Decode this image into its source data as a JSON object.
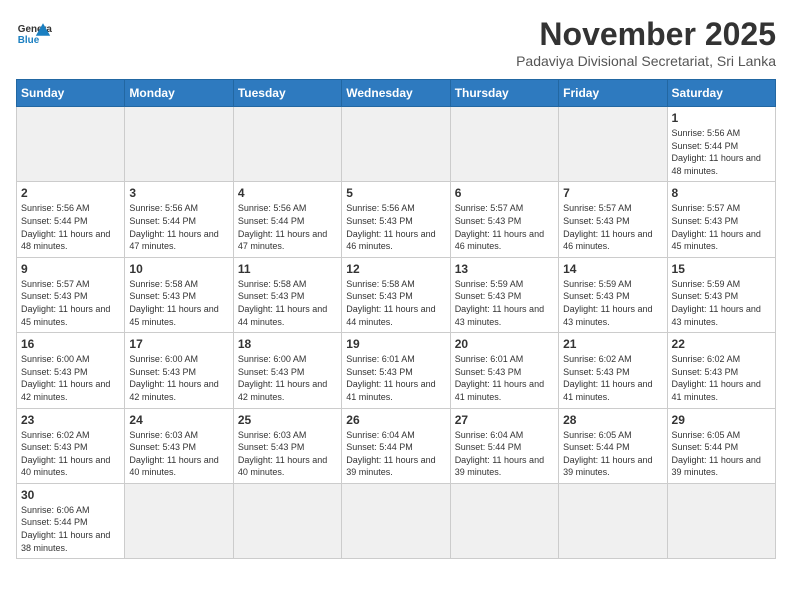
{
  "header": {
    "logo_general": "General",
    "logo_blue": "Blue",
    "month_title": "November 2025",
    "subtitle": "Padaviya Divisional Secretariat, Sri Lanka"
  },
  "weekdays": [
    "Sunday",
    "Monday",
    "Tuesday",
    "Wednesday",
    "Thursday",
    "Friday",
    "Saturday"
  ],
  "weeks": [
    [
      {
        "day": "",
        "sunrise": "",
        "sunset": "",
        "daylight": ""
      },
      {
        "day": "",
        "sunrise": "",
        "sunset": "",
        "daylight": ""
      },
      {
        "day": "",
        "sunrise": "",
        "sunset": "",
        "daylight": ""
      },
      {
        "day": "",
        "sunrise": "",
        "sunset": "",
        "daylight": ""
      },
      {
        "day": "",
        "sunrise": "",
        "sunset": "",
        "daylight": ""
      },
      {
        "day": "",
        "sunrise": "",
        "sunset": "",
        "daylight": ""
      },
      {
        "day": "1",
        "sunrise": "Sunrise: 5:56 AM",
        "sunset": "Sunset: 5:44 PM",
        "daylight": "Daylight: 11 hours and 48 minutes."
      }
    ],
    [
      {
        "day": "2",
        "sunrise": "Sunrise: 5:56 AM",
        "sunset": "Sunset: 5:44 PM",
        "daylight": "Daylight: 11 hours and 48 minutes."
      },
      {
        "day": "3",
        "sunrise": "Sunrise: 5:56 AM",
        "sunset": "Sunset: 5:44 PM",
        "daylight": "Daylight: 11 hours and 47 minutes."
      },
      {
        "day": "4",
        "sunrise": "Sunrise: 5:56 AM",
        "sunset": "Sunset: 5:44 PM",
        "daylight": "Daylight: 11 hours and 47 minutes."
      },
      {
        "day": "5",
        "sunrise": "Sunrise: 5:56 AM",
        "sunset": "Sunset: 5:43 PM",
        "daylight": "Daylight: 11 hours and 46 minutes."
      },
      {
        "day": "6",
        "sunrise": "Sunrise: 5:57 AM",
        "sunset": "Sunset: 5:43 PM",
        "daylight": "Daylight: 11 hours and 46 minutes."
      },
      {
        "day": "7",
        "sunrise": "Sunrise: 5:57 AM",
        "sunset": "Sunset: 5:43 PM",
        "daylight": "Daylight: 11 hours and 46 minutes."
      },
      {
        "day": "8",
        "sunrise": "Sunrise: 5:57 AM",
        "sunset": "Sunset: 5:43 PM",
        "daylight": "Daylight: 11 hours and 45 minutes."
      }
    ],
    [
      {
        "day": "9",
        "sunrise": "Sunrise: 5:57 AM",
        "sunset": "Sunset: 5:43 PM",
        "daylight": "Daylight: 11 hours and 45 minutes."
      },
      {
        "day": "10",
        "sunrise": "Sunrise: 5:58 AM",
        "sunset": "Sunset: 5:43 PM",
        "daylight": "Daylight: 11 hours and 45 minutes."
      },
      {
        "day": "11",
        "sunrise": "Sunrise: 5:58 AM",
        "sunset": "Sunset: 5:43 PM",
        "daylight": "Daylight: 11 hours and 44 minutes."
      },
      {
        "day": "12",
        "sunrise": "Sunrise: 5:58 AM",
        "sunset": "Sunset: 5:43 PM",
        "daylight": "Daylight: 11 hours and 44 minutes."
      },
      {
        "day": "13",
        "sunrise": "Sunrise: 5:59 AM",
        "sunset": "Sunset: 5:43 PM",
        "daylight": "Daylight: 11 hours and 43 minutes."
      },
      {
        "day": "14",
        "sunrise": "Sunrise: 5:59 AM",
        "sunset": "Sunset: 5:43 PM",
        "daylight": "Daylight: 11 hours and 43 minutes."
      },
      {
        "day": "15",
        "sunrise": "Sunrise: 5:59 AM",
        "sunset": "Sunset: 5:43 PM",
        "daylight": "Daylight: 11 hours and 43 minutes."
      }
    ],
    [
      {
        "day": "16",
        "sunrise": "Sunrise: 6:00 AM",
        "sunset": "Sunset: 5:43 PM",
        "daylight": "Daylight: 11 hours and 42 minutes."
      },
      {
        "day": "17",
        "sunrise": "Sunrise: 6:00 AM",
        "sunset": "Sunset: 5:43 PM",
        "daylight": "Daylight: 11 hours and 42 minutes."
      },
      {
        "day": "18",
        "sunrise": "Sunrise: 6:00 AM",
        "sunset": "Sunset: 5:43 PM",
        "daylight": "Daylight: 11 hours and 42 minutes."
      },
      {
        "day": "19",
        "sunrise": "Sunrise: 6:01 AM",
        "sunset": "Sunset: 5:43 PM",
        "daylight": "Daylight: 11 hours and 41 minutes."
      },
      {
        "day": "20",
        "sunrise": "Sunrise: 6:01 AM",
        "sunset": "Sunset: 5:43 PM",
        "daylight": "Daylight: 11 hours and 41 minutes."
      },
      {
        "day": "21",
        "sunrise": "Sunrise: 6:02 AM",
        "sunset": "Sunset: 5:43 PM",
        "daylight": "Daylight: 11 hours and 41 minutes."
      },
      {
        "day": "22",
        "sunrise": "Sunrise: 6:02 AM",
        "sunset": "Sunset: 5:43 PM",
        "daylight": "Daylight: 11 hours and 41 minutes."
      }
    ],
    [
      {
        "day": "23",
        "sunrise": "Sunrise: 6:02 AM",
        "sunset": "Sunset: 5:43 PM",
        "daylight": "Daylight: 11 hours and 40 minutes."
      },
      {
        "day": "24",
        "sunrise": "Sunrise: 6:03 AM",
        "sunset": "Sunset: 5:43 PM",
        "daylight": "Daylight: 11 hours and 40 minutes."
      },
      {
        "day": "25",
        "sunrise": "Sunrise: 6:03 AM",
        "sunset": "Sunset: 5:43 PM",
        "daylight": "Daylight: 11 hours and 40 minutes."
      },
      {
        "day": "26",
        "sunrise": "Sunrise: 6:04 AM",
        "sunset": "Sunset: 5:44 PM",
        "daylight": "Daylight: 11 hours and 39 minutes."
      },
      {
        "day": "27",
        "sunrise": "Sunrise: 6:04 AM",
        "sunset": "Sunset: 5:44 PM",
        "daylight": "Daylight: 11 hours and 39 minutes."
      },
      {
        "day": "28",
        "sunrise": "Sunrise: 6:05 AM",
        "sunset": "Sunset: 5:44 PM",
        "daylight": "Daylight: 11 hours and 39 minutes."
      },
      {
        "day": "29",
        "sunrise": "Sunrise: 6:05 AM",
        "sunset": "Sunset: 5:44 PM",
        "daylight": "Daylight: 11 hours and 39 minutes."
      }
    ],
    [
      {
        "day": "30",
        "sunrise": "Sunrise: 6:06 AM",
        "sunset": "Sunset: 5:44 PM",
        "daylight": "Daylight: 11 hours and 38 minutes."
      },
      {
        "day": "",
        "sunrise": "",
        "sunset": "",
        "daylight": ""
      },
      {
        "day": "",
        "sunrise": "",
        "sunset": "",
        "daylight": ""
      },
      {
        "day": "",
        "sunrise": "",
        "sunset": "",
        "daylight": ""
      },
      {
        "day": "",
        "sunrise": "",
        "sunset": "",
        "daylight": ""
      },
      {
        "day": "",
        "sunrise": "",
        "sunset": "",
        "daylight": ""
      },
      {
        "day": "",
        "sunrise": "",
        "sunset": "",
        "daylight": ""
      }
    ]
  ]
}
